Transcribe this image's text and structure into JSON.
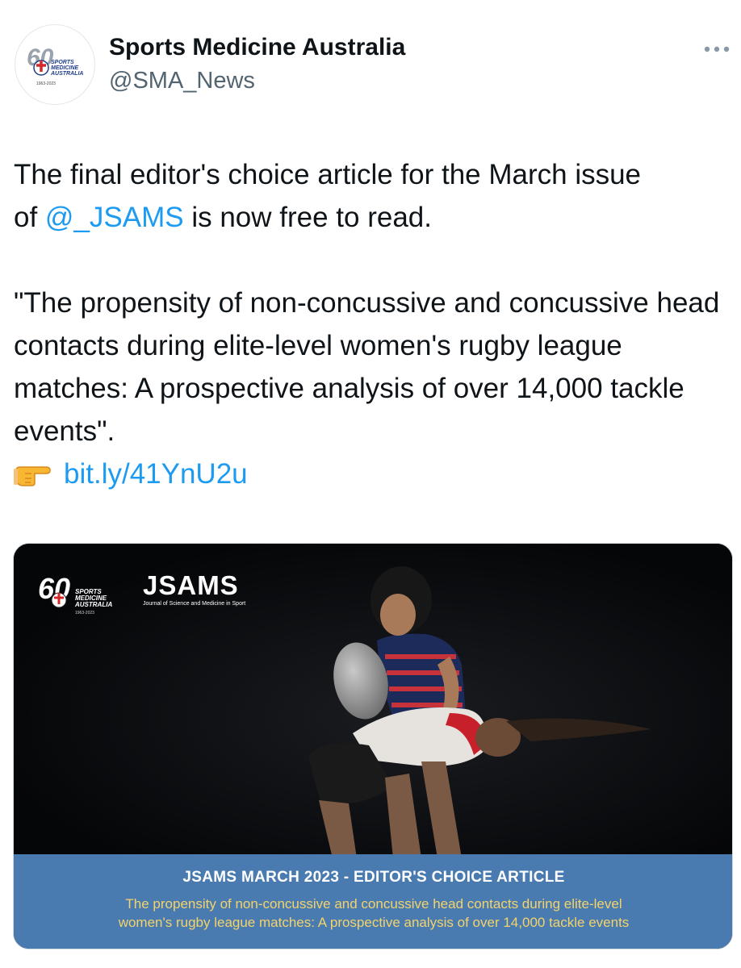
{
  "author": {
    "display_name": "Sports Medicine Australia",
    "handle": "@SMA_News"
  },
  "avatar_logo": {
    "number": "60",
    "lines": [
      "SPORTS",
      "MEDICINE",
      "AUSTRALIA"
    ],
    "years": "1963-2023"
  },
  "tweet": {
    "line1_pre": "The final editor's choice article for the March issue",
    "line2_pre": "of ",
    "mention": "@_JSAMS",
    "line2_post": " is now free to read.",
    "quote": "\"The propensity of non-concussive and concussive head contacts during elite-level women's rugby league matches: A prospective analysis of over 14,000 tackle events\".",
    "link": "bit.ly/41YnU2u"
  },
  "media": {
    "sma_logo": {
      "number": "60",
      "lines": [
        "SPORTS",
        "MEDICINE",
        "AUSTRALIA"
      ],
      "years": "1963-2023"
    },
    "jsams_title": "JSAMS",
    "jsams_subtitle": "Journal of Science and Medicine in Sport",
    "banner_title": "JSAMS MARCH 2023 - EDITOR'S CHOICE ARTICLE",
    "banner_desc_line1": "The propensity of non-concussive and concussive head contacts during elite-level",
    "banner_desc_line2": "women's rugby league matches: A prospective analysis of over 14,000 tackle events"
  },
  "colors": {
    "link": "#1d9bf0",
    "banner_bg": "#4a7bb0",
    "banner_desc": "#f3d36b",
    "secondary_text": "#536471"
  },
  "icons": {
    "more": "more-horizontal-icon",
    "pointing": "backhand-index-pointing-right-icon"
  }
}
